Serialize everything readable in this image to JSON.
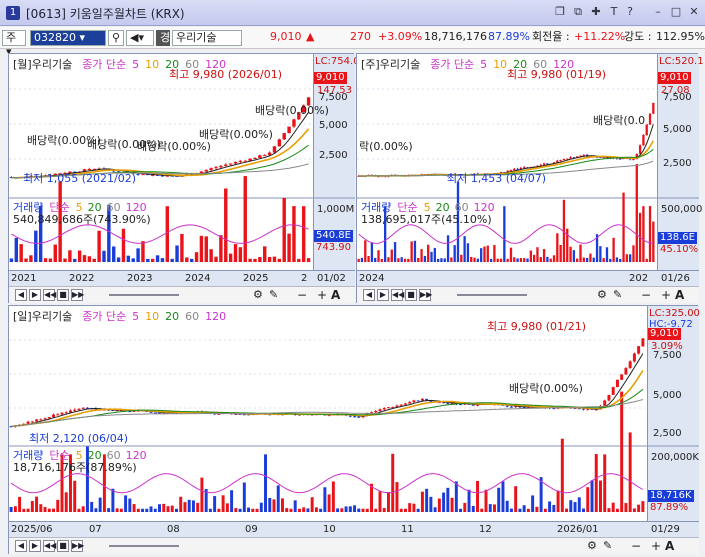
{
  "window": {
    "number": "1",
    "title": "[0613] 키움일주월차트 (KRX)"
  },
  "titlebar_icons": [
    "restore-icon",
    "copy-icon",
    "pin-icon",
    "T",
    "?",
    "minimize-icon",
    "close-icon"
  ],
  "toolbar": {
    "market": "주",
    "code": "032820",
    "search_icon": "search-icon",
    "speaker_icon": "speaker-icon",
    "badge": "경",
    "name": "우리기술",
    "price": "9,010",
    "change_arrow": "▲",
    "change": "270",
    "change_pct": "+3.09%",
    "volume": "18,716,176",
    "vol_ratio": "87.89%",
    "turnover_label": "회전율 :",
    "turnover": "+11.22%",
    "strength_label": "강도 :",
    "strength": "112.95%"
  },
  "colors": {
    "up": "#e8141a",
    "down": "#1a3dd8",
    "ma5": "#222222",
    "ma10": "#e8a000",
    "ma20": "#1a8a1a",
    "ma60": "#888888",
    "ma120": "#cc33cc",
    "accent": "#cc1111"
  },
  "panels": {
    "monthly": {
      "title": "[월]우리기술",
      "series_label": "종가 단순",
      "ma": [
        "5",
        "10",
        "20",
        "60",
        "120"
      ],
      "high_label": "최고 9,980 (2026/01)",
      "low_label": "최저 1,055 (2021/02)",
      "lc": "LC:754.00",
      "price_tag": "9,010",
      "pct_tag": "147.53",
      "y_ticks": [
        "7,500",
        "5,000",
        "2,500"
      ],
      "events": [
        "배당락(0.00%)",
        "배당락(0.00%)",
        "배당락(0.00%)",
        "배당락(0.00%)",
        "배당락(0.00%)"
      ],
      "vol_header": "거래량",
      "vol_series": "단순",
      "vol_ma": [
        "5",
        "20",
        "60",
        "120"
      ],
      "vol_value": "540,849,686주(743.90%)",
      "vol_tag1": "540.8E",
      "vol_tag2": "743.90",
      "vol_y": "1,000M",
      "x_ticks": [
        "2021",
        "2022",
        "2023",
        "2024",
        "2025",
        "2"
      ],
      "date": "01/02"
    },
    "weekly": {
      "title": "[주]우리기술",
      "series_label": "종가 단순",
      "ma": [
        "5",
        "10",
        "20",
        "60",
        "120"
      ],
      "high_label": "최고 9,980 (01/19)",
      "low_label": "최저 1,453 (04/07)",
      "lc": "LC:520.1",
      "price_tag": "9,010",
      "pct_tag": "27.08",
      "y_ticks": [
        "7,500",
        "5,000",
        "2,500"
      ],
      "events": [
        "락(0.00%)",
        "배당락(0.0"
      ],
      "vol_header": "거래량",
      "vol_series": "단순",
      "vol_ma": [
        "5",
        "20",
        "60",
        "120"
      ],
      "vol_value": "138,695,017주(45.10%)",
      "vol_tag1": "138.6E",
      "vol_tag2": "45.10%",
      "vol_y": "500,000",
      "x_ticks": [
        "2024",
        "202"
      ],
      "date": "01/26"
    },
    "daily": {
      "title": "[일]우리기술",
      "series_label": "종가 단순",
      "ma": [
        "5",
        "10",
        "20",
        "60",
        "120"
      ],
      "high_label": "최고 9,980 (01/21)",
      "low_label": "최저 2,120 (06/04)",
      "lc": "LC:325.00",
      "hc": "HC:-9.72",
      "price_tag": "9,010",
      "pct_tag": "3.09%",
      "y_ticks": [
        "7,500",
        "5,000",
        "2,500"
      ],
      "events": [
        "배당락(0.00%)"
      ],
      "vol_header": "거래량",
      "vol_series": "단순",
      "vol_ma": [
        "5",
        "20",
        "60",
        "120"
      ],
      "vol_value": "18,716,176주(87.89%)",
      "vol_tag1": "18,716K",
      "vol_tag2": "87.89%",
      "vol_y": "200,000K",
      "x_ticks": [
        "2025/06",
        "07",
        "08",
        "09",
        "10",
        "11",
        "12",
        "2026/01"
      ],
      "date": "01/29"
    }
  },
  "nav": {
    "buttons": [
      "◀",
      "▶",
      "◀◀",
      "■",
      "▶▶"
    ],
    "tools": [
      "+",
      "A",
      "−"
    ]
  }
}
